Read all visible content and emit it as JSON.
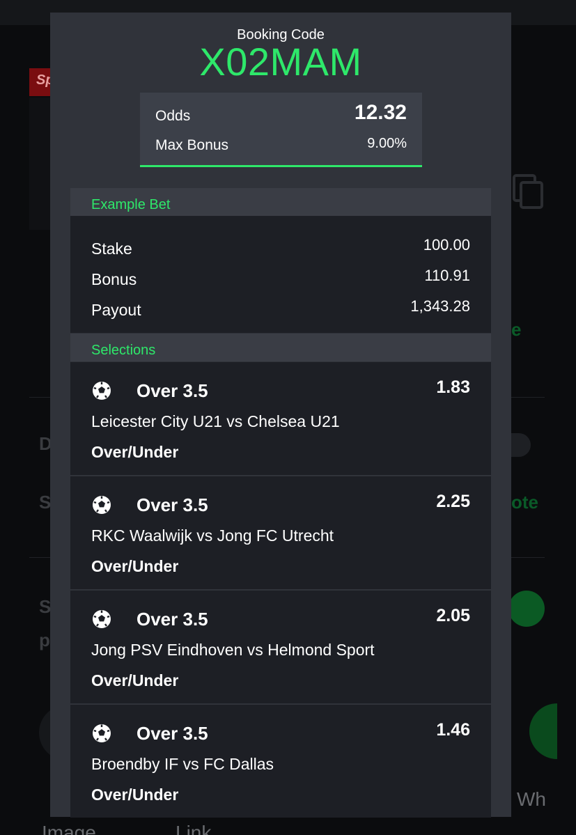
{
  "background": {
    "tag_text": "Sp",
    "row_texts": [
      "D",
      "S",
      "S",
      "p"
    ],
    "green_text_1": "e",
    "green_text_2": "ote",
    "bottom_labels": [
      "Image",
      "Link",
      "Wh"
    ]
  },
  "modal": {
    "title": "Booking Code",
    "code": "X02MAM",
    "odds_label": "Odds",
    "odds_value": "12.32",
    "max_bonus_label": "Max Bonus",
    "max_bonus_value": "9.00%"
  },
  "example_bet": {
    "header": "Example Bet",
    "rows": [
      {
        "label": "Stake",
        "value": "100.00"
      },
      {
        "label": "Bonus",
        "value": "110.91"
      },
      {
        "label": "Payout",
        "value": "1,343.28"
      }
    ]
  },
  "selections": {
    "header": "Selections",
    "items": [
      {
        "pick": "Over 3.5",
        "odds": "1.83",
        "match": "Leicester City U21 vs Chelsea U21",
        "market": "Over/Under",
        "icon": "soccer-ball-icon"
      },
      {
        "pick": "Over 3.5",
        "odds": "2.25",
        "match": "RKC Waalwijk vs Jong FC Utrecht",
        "market": "Over/Under",
        "icon": "soccer-ball-icon"
      },
      {
        "pick": "Over 3.5",
        "odds": "2.05",
        "match": "Jong PSV Eindhoven vs Helmond Sport",
        "market": "Over/Under",
        "icon": "soccer-ball-icon"
      },
      {
        "pick": "Over 3.5",
        "odds": "1.46",
        "match": "Broendby IF vs FC Dallas",
        "market": "Over/Under",
        "icon": "soccer-ball-icon"
      }
    ]
  },
  "colors": {
    "accent": "#2ee86a",
    "modal_bg": "#30333a",
    "card_bg": "#1d1f25",
    "section_header_bg": "#3a3d45"
  }
}
